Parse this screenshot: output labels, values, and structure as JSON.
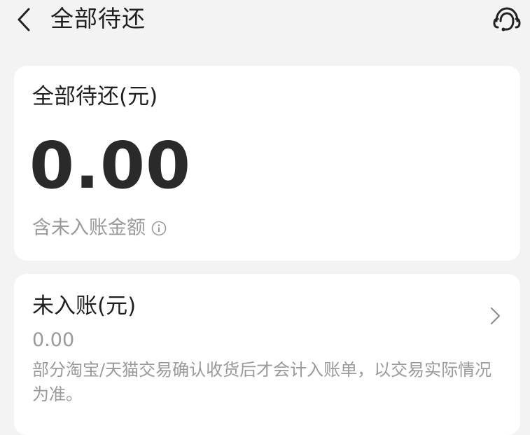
{
  "header": {
    "back_icon": "chevron-left-icon",
    "title": "全部待还",
    "service_icon": "customer-service-icon"
  },
  "total_card": {
    "label": "全部待还(元)",
    "amount": "0.00",
    "note": "含未入账金额",
    "note_icon": "info-icon"
  },
  "unbilled_card": {
    "label": "未入账(元)",
    "amount": "0.00",
    "description": "部分淘宝/天猫交易确认收货后才会计入账单，以交易实际情况为准。",
    "arrow_icon": "chevron-right-icon"
  },
  "colors": {
    "background": "#f3f3f3",
    "card": "#ffffff",
    "primary_text": "#1f1f1f",
    "secondary_text": "#9a9a9a"
  }
}
